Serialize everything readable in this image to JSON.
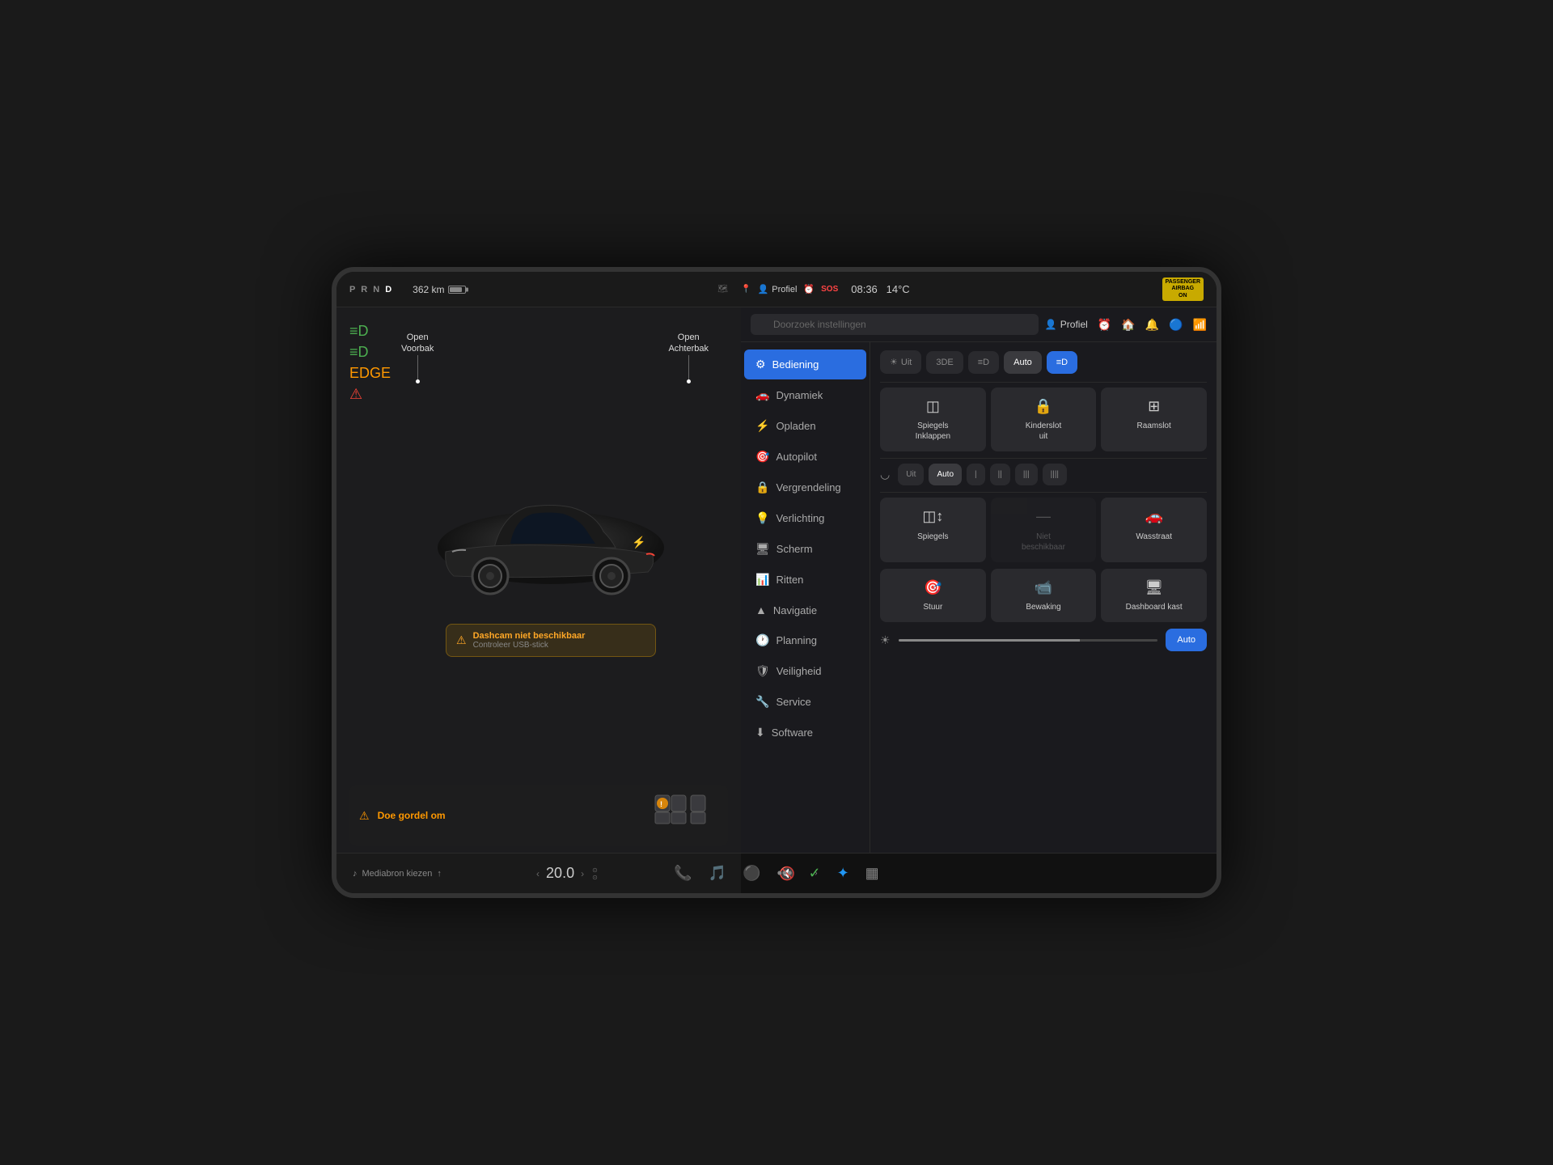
{
  "statusBar": {
    "prnd": {
      "p": "P",
      "r": "R",
      "n": "N",
      "d": "D",
      "active": "D"
    },
    "range": "362 km",
    "profileLabel": "Profiel",
    "time": "08:36",
    "temperature": "14°C",
    "passengerAirbag": "PASSENGER\nAIRBAG\nON",
    "sosLabel": "SOS"
  },
  "search": {
    "placeholder": "Doorzoek instellingen"
  },
  "headerIcons": {
    "profileLabel": "Profiel"
  },
  "menu": {
    "items": [
      {
        "id": "bediening",
        "icon": "🎮",
        "label": "Bediening",
        "active": true
      },
      {
        "id": "dynamiek",
        "icon": "🚗",
        "label": "Dynamiek",
        "active": false
      },
      {
        "id": "opladen",
        "icon": "⚡",
        "label": "Opladen",
        "active": false
      },
      {
        "id": "autopilot",
        "icon": "🎯",
        "label": "Autopilot",
        "active": false
      },
      {
        "id": "vergrendeling",
        "icon": "🔒",
        "label": "Vergrendeling",
        "active": false
      },
      {
        "id": "verlichting",
        "icon": "💡",
        "label": "Verlichting",
        "active": false
      },
      {
        "id": "scherm",
        "icon": "🖥",
        "label": "Scherm",
        "active": false
      },
      {
        "id": "ritten",
        "icon": "📊",
        "label": "Ritten",
        "active": false
      },
      {
        "id": "navigatie",
        "icon": "🗺",
        "label": "Navigatie",
        "active": false
      },
      {
        "id": "planning",
        "icon": "🕐",
        "label": "Planning",
        "active": false
      },
      {
        "id": "veiligheid",
        "icon": "🛡",
        "label": "Veiligheid",
        "active": false
      },
      {
        "id": "service",
        "icon": "🔧",
        "label": "Service",
        "active": false
      },
      {
        "id": "software",
        "icon": "⬇",
        "label": "Software",
        "active": false
      }
    ]
  },
  "controls": {
    "lightButtons": [
      {
        "label": "Uit",
        "icon": "☀",
        "active": false
      },
      {
        "label": "3DE",
        "active": false
      },
      {
        "label": "D",
        "icon": "≡D",
        "active": false
      },
      {
        "label": "Auto",
        "active": false
      },
      {
        "label": "≡D",
        "active": true,
        "isBlue": true
      }
    ],
    "gridButtons": [
      {
        "label": "Spiegels\nInklappen",
        "icon": "◫",
        "active": true
      },
      {
        "label": "Kinderslot\nuit",
        "icon": "🔒",
        "active": true
      },
      {
        "label": "Raamslot",
        "icon": "⊞",
        "active": true
      }
    ],
    "wiperButtons": [
      {
        "label": "Uit",
        "active": false
      },
      {
        "label": "Auto",
        "active": true
      },
      {
        "label": "|",
        "active": false
      },
      {
        "label": "||",
        "active": false
      },
      {
        "label": "|||",
        "active": false
      },
      {
        "label": "||||",
        "active": false
      }
    ],
    "actionButtons": [
      {
        "label": "Spiegels",
        "icon": "◫↕",
        "active": true
      },
      {
        "label": "Niet\nbeschikbaar",
        "icon": "—",
        "inactive": true
      },
      {
        "label": "Wasstraat",
        "icon": "🚗",
        "active": true
      }
    ],
    "actionButtons2": [
      {
        "label": "Stuur",
        "icon": "🎯",
        "active": true
      },
      {
        "label": "Bewaking",
        "icon": "📹",
        "active": true
      },
      {
        "label": "Dashboard kast",
        "icon": "🖥",
        "active": true
      }
    ],
    "autoBtn": "Auto",
    "brightnessValue": 70
  },
  "carView": {
    "labelFront": {
      "line1": "Open",
      "line2": "Voorbak"
    },
    "labelRear": {
      "line1": "Open",
      "line2": "Achterbak"
    },
    "warning": {
      "title": "Dashcam niet beschikbaar",
      "subtitle": "Controleer USB-stick"
    },
    "seatbelt": "Doe gordel om"
  },
  "bottomBar": {
    "mediaSource": "Mediabron kiezen",
    "speed": "20.0",
    "speedUnit": ""
  },
  "taskbar": {
    "icons": [
      "📞",
      "🎵",
      "⚫",
      "•••",
      "✓",
      "✦",
      "▦"
    ],
    "volumeIcon": "🔊",
    "arrows": [
      "‹",
      "›"
    ]
  },
  "indicators": [
    {
      "symbol": "≡D",
      "color": "green"
    },
    {
      "symbol": "≡D",
      "color": "green"
    },
    {
      "symbol": "EDGE",
      "color": "green"
    },
    {
      "symbol": "⚠",
      "color": "red"
    }
  ]
}
